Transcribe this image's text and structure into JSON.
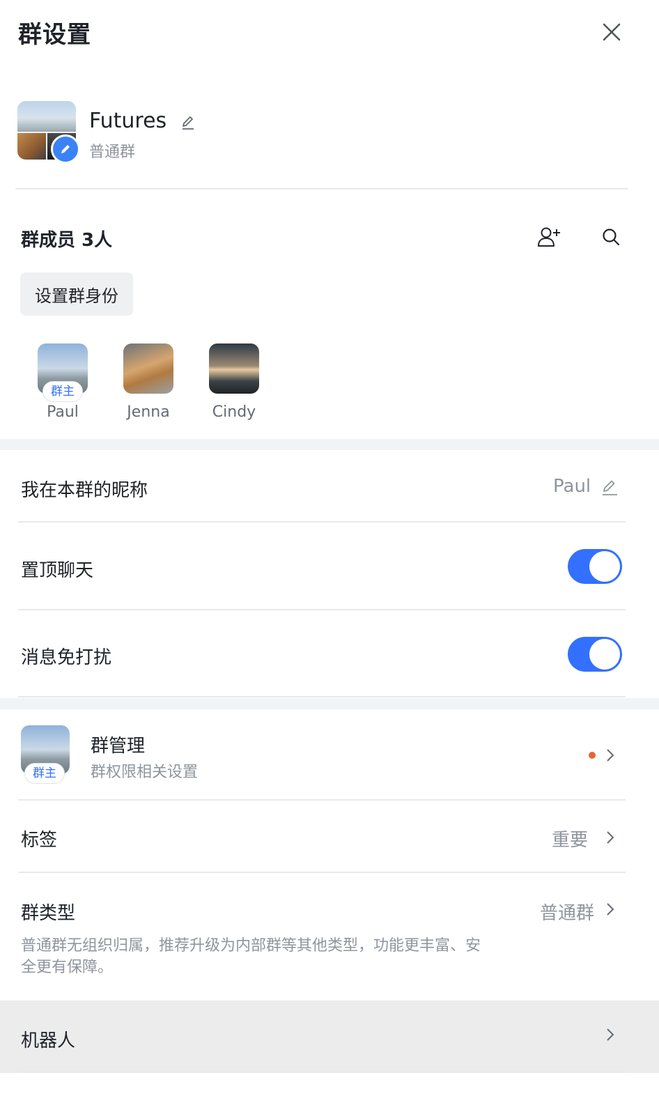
{
  "header": {
    "title": "群设置",
    "close_icon": "close-icon"
  },
  "group": {
    "name": "Futures",
    "type": "普通群",
    "edit_icon": "pencil-icon"
  },
  "members": {
    "title": "群成员 3人",
    "add_icon": "add-member-icon",
    "search_icon": "search-icon",
    "role_button": "设置群身份",
    "list": [
      {
        "name": "Paul",
        "tag": "群主"
      },
      {
        "name": "Jenna"
      },
      {
        "name": "Cindy"
      }
    ]
  },
  "settings": {
    "nickname": {
      "label": "我在本群的昵称",
      "value": "Paul"
    },
    "pin": {
      "label": "置顶聊天",
      "on": true
    },
    "mute": {
      "label": "消息免打扰",
      "on": true
    }
  },
  "management": {
    "title": "群管理",
    "subtitle": "群权限相关设置",
    "tag": "群主",
    "dot_color": "#e8652f"
  },
  "labels": {
    "label": "标签",
    "value": "重要"
  },
  "group_type": {
    "label": "群类型",
    "value": "普通群",
    "description": "普通群无组织归属，推荐升级为内部群等其他类型，功能更丰富、安全更有保障。"
  },
  "robot": {
    "label": "机器人"
  },
  "colors": {
    "accent": "#3370ff",
    "toggle_on": "#3370ff",
    "text_secondary": "#8f959e"
  }
}
